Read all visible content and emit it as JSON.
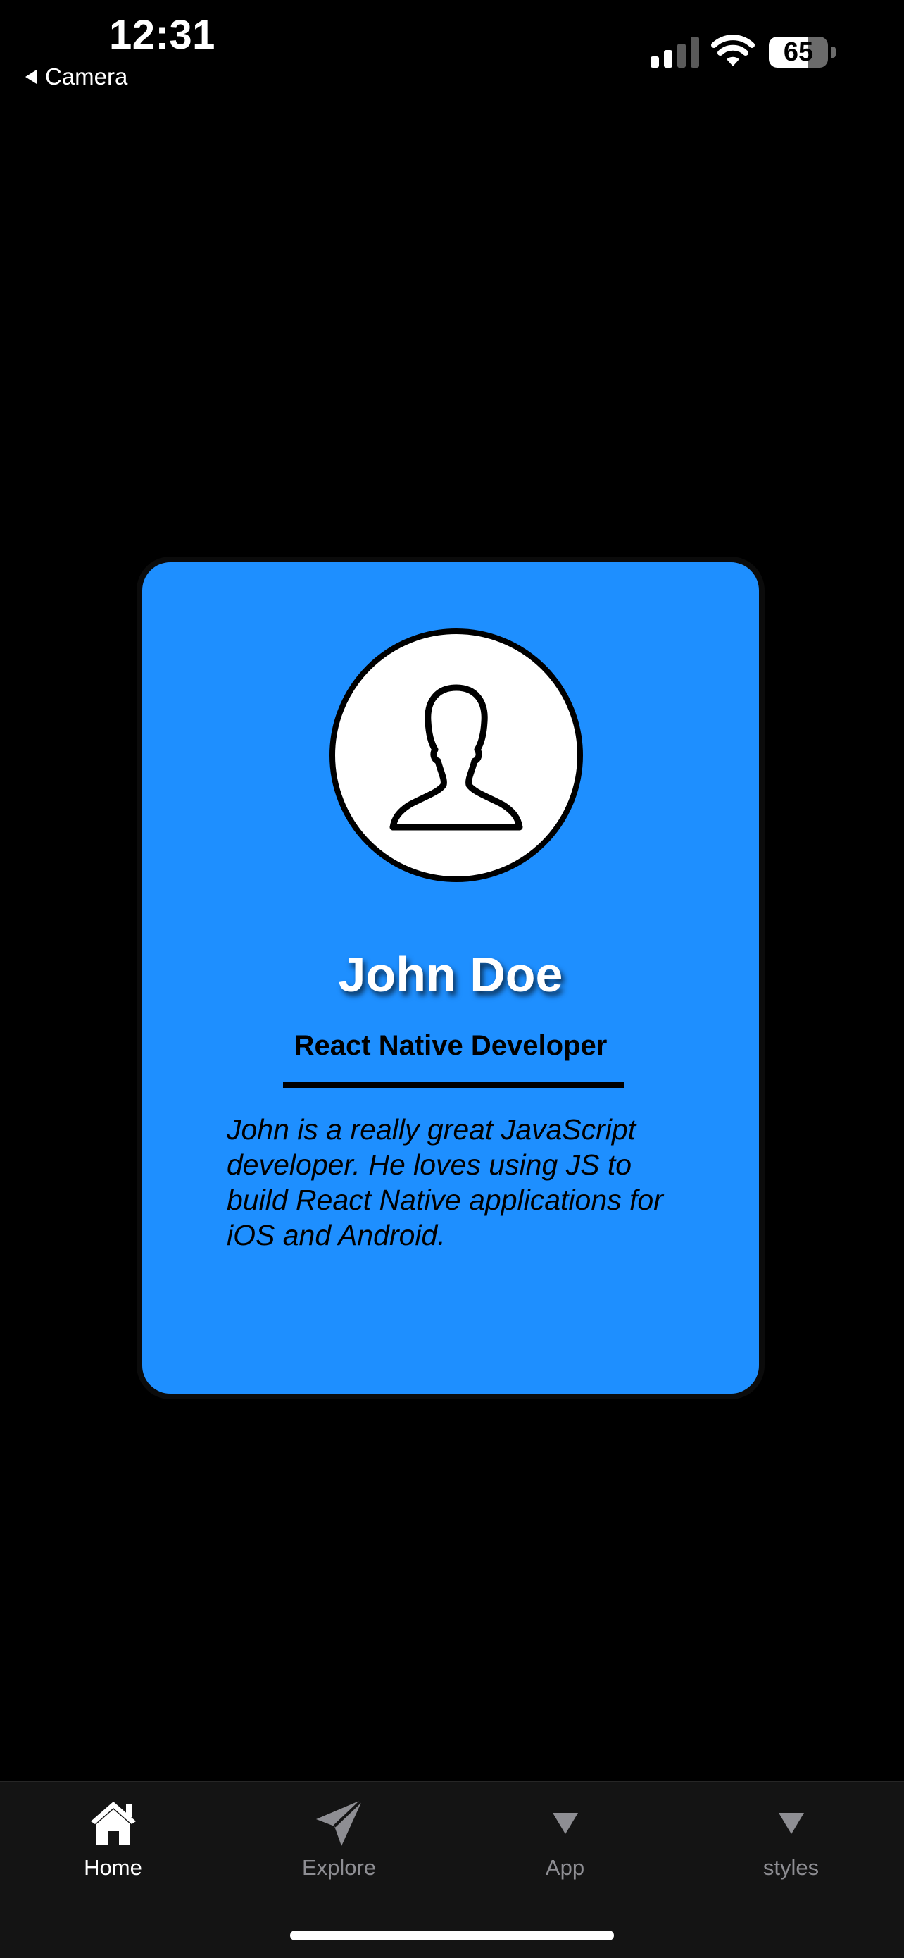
{
  "status_bar": {
    "time": "12:31",
    "back_label": "Camera",
    "battery_percent": 65,
    "battery_text": "65"
  },
  "card": {
    "name": "John Doe",
    "role": "React Native Developer",
    "bio": "John is a really great JavaScript developer. He loves using JS to build React Native applications for iOS and Android.",
    "background_color": "#1e8fff"
  },
  "tabs": [
    {
      "label": "Home",
      "icon": "house-icon",
      "active": true
    },
    {
      "label": "Explore",
      "icon": "paper-plane-icon",
      "active": false
    },
    {
      "label": "App",
      "icon": "triangle-down-icon",
      "active": false
    },
    {
      "label": "styles",
      "icon": "triangle-down-icon",
      "active": false
    }
  ]
}
